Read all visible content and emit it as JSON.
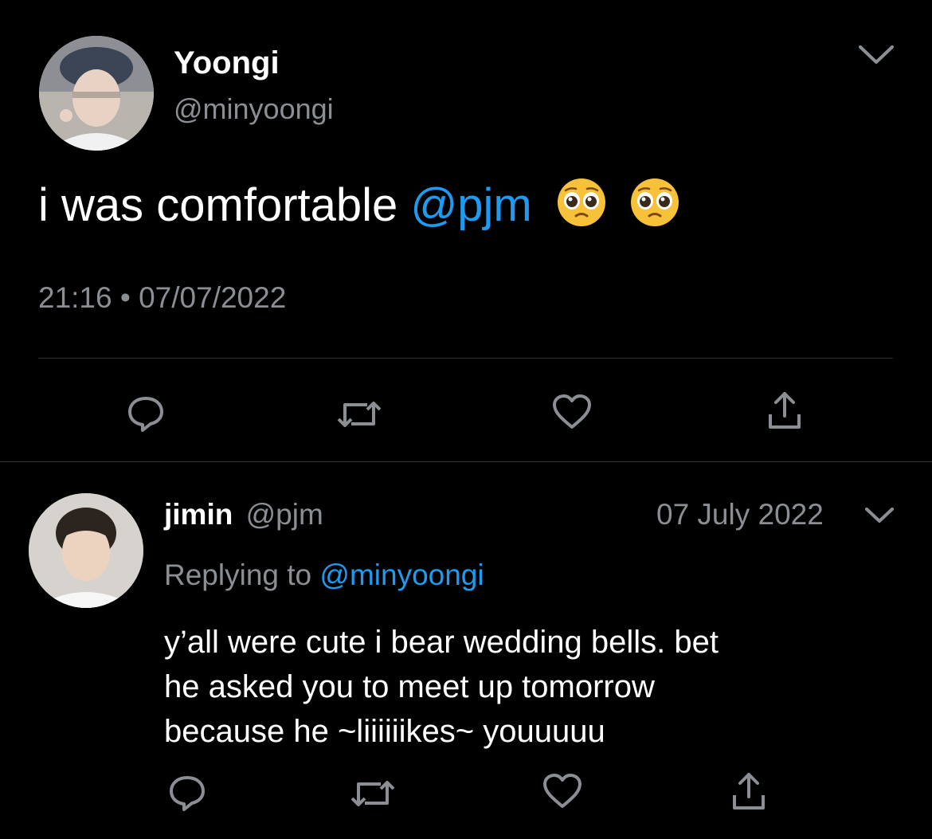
{
  "main_tweet": {
    "author_name": "Yoongi",
    "author_handle": "@minyoongi",
    "text_prefix": "i was comfortable ",
    "mention": "@pjm",
    "emojis": [
      "pleading-face-emoji",
      "pleading-face-emoji"
    ],
    "timestamp": "21:16 • 07/07/2022"
  },
  "reply": {
    "author_name": "jimin",
    "author_handle": "@pjm",
    "date": "07 July 2022",
    "replying_to_label": "Replying to ",
    "replying_to_handle": "@minyoongi",
    "text_lines": [
      "y’all were cute i bear wedding bells. bet",
      "he asked you to meet up tomorrow",
      "because he ~liiiiiikes~ youuuuu"
    ]
  },
  "actions": [
    "reply-icon",
    "retweet-icon",
    "like-icon",
    "share-icon"
  ],
  "colors": {
    "background": "#000000",
    "link": "#1d9bf0",
    "muted": "#8b8f94",
    "divider": "#2f3336"
  }
}
